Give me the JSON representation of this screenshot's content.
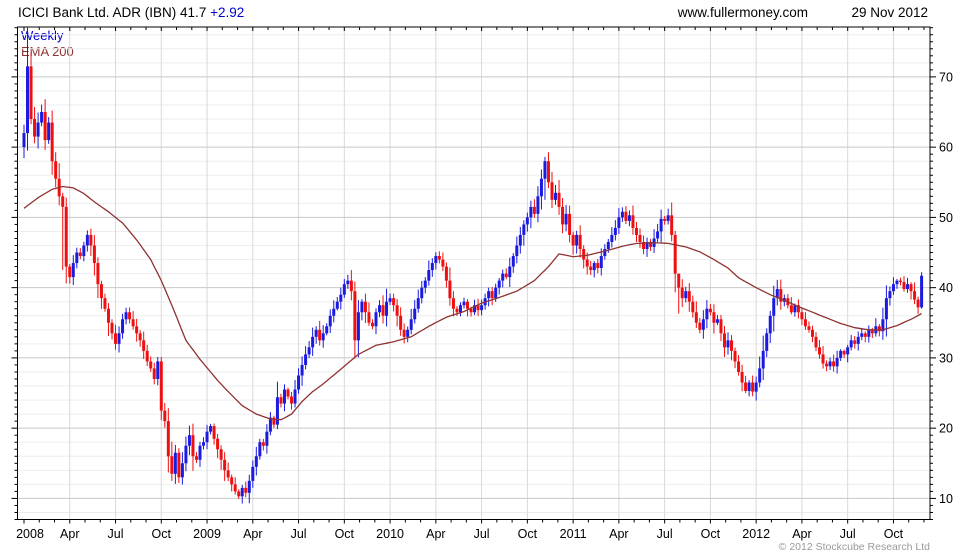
{
  "header": {
    "title_main": "ICICI Bank Ltd. ADR (IBN) 41.7 ",
    "title_change": "+2.92",
    "site": "www.fullermoney.com",
    "date": "29 Nov 2012"
  },
  "legend": {
    "timeframe": "Weekly",
    "ema": "EMA 200"
  },
  "footer": {
    "copyright": "© 2012 Stockcube Research Ltd"
  },
  "colors": {
    "up": "#1a1ae0",
    "down": "#ee1010",
    "ema": "#8f3232",
    "grid_minor": "#ededed",
    "grid_major": "#c8c8c8",
    "grid_vertical": "#d9d9d9",
    "frame": "#000000",
    "text": "#000000",
    "accent_blue": "#0000cc",
    "copyright": "#9a9a9a"
  },
  "chart_data": {
    "type": "candlestick",
    "title": "ICICI Bank Ltd. ADR (IBN)",
    "timeframe": "Weekly",
    "overlay": "EMA 200",
    "last_price": 41.7,
    "change": "+2.92",
    "as_of": "29 Nov 2012",
    "x_range": "Jan 2008 - Nov 2012",
    "y_axis": {
      "min": 7,
      "max": 77.1,
      "tick_labels": [
        10,
        20,
        30,
        40,
        50,
        60,
        70
      ],
      "minor_grid_step": 2
    },
    "x_tick_labels": [
      "2008",
      "Apr",
      "Jul",
      "Oct",
      "2009",
      "Apr",
      "Jul",
      "Oct",
      "2010",
      "Apr",
      "Jul",
      "Oct",
      "2011",
      "Apr",
      "Jul",
      "Oct",
      "2012",
      "Apr",
      "Jul",
      "Oct"
    ],
    "months_per_x_label": 3,
    "first_open": 60,
    "weekly_closes": [
      62,
      71.5,
      64,
      61.5,
      63.5,
      65,
      61,
      63.5,
      58,
      55.5,
      53,
      51.5,
      43,
      41.5,
      43.5,
      45,
      44.5,
      46,
      47.5,
      46,
      43.5,
      40.5,
      38.5,
      37,
      35,
      33.5,
      32,
      33.5,
      35.5,
      36.5,
      35.5,
      34.5,
      33.5,
      32.5,
      31,
      29.5,
      28.5,
      27,
      29.5,
      22.5,
      21,
      16,
      13.5,
      16.5,
      13,
      15,
      17.5,
      19,
      16,
      15.5,
      17.5,
      18,
      19.5,
      20.3,
      18.5,
      17,
      15.5,
      14,
      13,
      12,
      11,
      10.3,
      11.5,
      10.8,
      12.5,
      14.5,
      16,
      18,
      17.5,
      19.5,
      21.5,
      20.5,
      24.4,
      23.5,
      25.5,
      24.5,
      23.5,
      25.5,
      27.5,
      29,
      30.5,
      31.5,
      33,
      34,
      32.5,
      33.5,
      34.5,
      36,
      37,
      38,
      39,
      40.5,
      41,
      39.5,
      32.5,
      36.5,
      38,
      36.5,
      35,
      34.5,
      36.5,
      37.5,
      36,
      38,
      38.5,
      37.5,
      36,
      34,
      33,
      34,
      35.5,
      37,
      38.5,
      40,
      41,
      42.5,
      43.5,
      44.5,
      44,
      43,
      41,
      38.5,
      37,
      36.5,
      37.5,
      38,
      37,
      36.5,
      37.5,
      36.8,
      37.5,
      38.5,
      39.5,
      38.5,
      40,
      41,
      42,
      41.5,
      43,
      44.5,
      46,
      47.5,
      49,
      50,
      51.5,
      50.5,
      53,
      55.5,
      58,
      55,
      52.5,
      53.5,
      51.5,
      49,
      50.5,
      47.5,
      46,
      47.5,
      45.5,
      44,
      43,
      42.5,
      43.5,
      42.8,
      44.5,
      45.5,
      46.5,
      47.5,
      48.5,
      50,
      50.8,
      49.5,
      50.3,
      48.5,
      47.5,
      46.5,
      45.5,
      46.5,
      45.8,
      47,
      48,
      49.8,
      49.5,
      50.3,
      47.5,
      42,
      40,
      38.5,
      39.5,
      38,
      36.5,
      35,
      34,
      35.5,
      37,
      36.5,
      35,
      35.5,
      33.5,
      31.5,
      32.5,
      31,
      29.5,
      28,
      26.5,
      25.3,
      26.5,
      25.2,
      26.5,
      28.5,
      31,
      33.5,
      36,
      38.5,
      39.8,
      38,
      38.5,
      37.5,
      36.5,
      37.5,
      36.5,
      35.5,
      34.5,
      34,
      33,
      31.5,
      30.5,
      29.2,
      28.8,
      29.5,
      28.8,
      30,
      31,
      30.5,
      31.5,
      32.5,
      32,
      33,
      33.5,
      33,
      34,
      33.5,
      34.5,
      33.8,
      35.5,
      38.5,
      39.5,
      40.5,
      41,
      40.8,
      39.8,
      40.5,
      39.5,
      38.3,
      37.2,
      41.7
    ],
    "wick_overrides": {
      "1": [
        77,
        59.5
      ],
      "11": [
        53.5,
        42.5
      ],
      "61": [
        11.3,
        9.9
      ],
      "148": [
        58.6,
        52.5
      ],
      "186": [
        40.8,
        36.3
      ],
      "255": [
        42.2,
        37.0
      ]
    },
    "ema_points": [
      [
        0,
        51.3
      ],
      [
        4,
        52.8
      ],
      [
        8,
        54.0
      ],
      [
        11,
        54.4
      ],
      [
        14,
        54.2
      ],
      [
        17,
        53.4
      ],
      [
        20,
        52.2
      ],
      [
        24,
        50.8
      ],
      [
        28,
        49.2
      ],
      [
        32,
        46.8
      ],
      [
        36,
        44.0
      ],
      [
        39,
        41.0
      ],
      [
        42,
        37.5
      ],
      [
        46,
        32.5
      ],
      [
        50,
        29.8
      ],
      [
        55,
        26.8
      ],
      [
        58,
        25.2
      ],
      [
        62,
        23.2
      ],
      [
        66,
        22.0
      ],
      [
        70,
        21.3
      ],
      [
        73,
        21.2
      ],
      [
        76,
        22.0
      ],
      [
        79,
        23.8
      ],
      [
        82,
        25.2
      ],
      [
        85,
        26.3
      ],
      [
        90,
        28.4
      ],
      [
        95,
        30.5
      ],
      [
        100,
        31.8
      ],
      [
        105,
        32.3
      ],
      [
        110,
        33.0
      ],
      [
        115,
        34.5
      ],
      [
        120,
        35.8
      ],
      [
        125,
        36.6
      ],
      [
        130,
        37.8
      ],
      [
        135,
        38.6
      ],
      [
        140,
        39.5
      ],
      [
        145,
        41.0
      ],
      [
        149,
        43.0
      ],
      [
        152,
        44.8
      ],
      [
        156,
        44.4
      ],
      [
        160,
        44.6
      ],
      [
        165,
        45.2
      ],
      [
        170,
        45.9
      ],
      [
        174,
        46.3
      ],
      [
        179,
        46.4
      ],
      [
        183,
        46.3
      ],
      [
        188,
        45.8
      ],
      [
        192,
        45.1
      ],
      [
        196,
        44.0
      ],
      [
        200,
        42.8
      ],
      [
        203,
        41.4
      ],
      [
        208,
        40.0
      ],
      [
        212,
        39.0
      ],
      [
        216,
        38.2
      ],
      [
        220,
        37.3
      ],
      [
        224,
        36.5
      ],
      [
        228,
        35.7
      ],
      [
        232,
        34.9
      ],
      [
        236,
        34.3
      ],
      [
        240,
        34.0
      ],
      [
        244,
        34.0
      ],
      [
        248,
        34.6
      ],
      [
        252,
        35.5
      ],
      [
        255,
        36.3
      ]
    ]
  }
}
